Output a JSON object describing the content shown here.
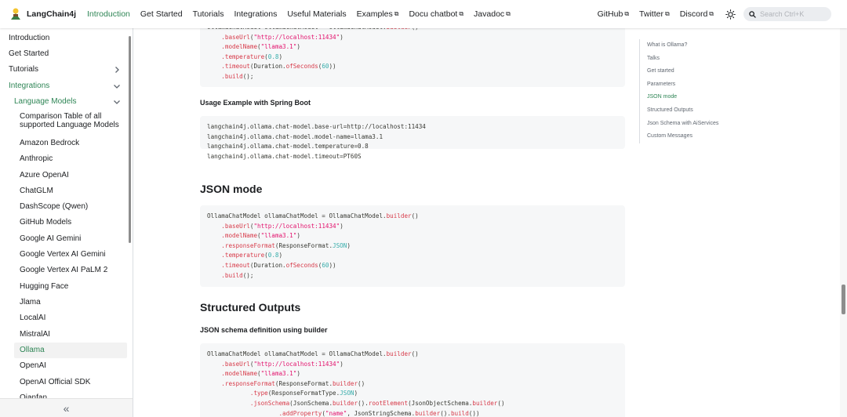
{
  "navbar": {
    "brand": "LangChain4j",
    "links": [
      {
        "label": "Introduction",
        "active": true,
        "external": false
      },
      {
        "label": "Get Started",
        "external": false
      },
      {
        "label": "Tutorials",
        "external": false
      },
      {
        "label": "Integrations",
        "external": false
      },
      {
        "label": "Useful Materials",
        "external": false
      },
      {
        "label": "Examples",
        "external": true
      },
      {
        "label": "Docu chatbot",
        "external": true
      },
      {
        "label": "Javadoc",
        "external": true
      }
    ],
    "right_links": [
      {
        "label": "GitHub",
        "external": true
      },
      {
        "label": "Twitter",
        "external": true
      },
      {
        "label": "Discord",
        "external": true
      }
    ],
    "search_placeholder": "Search Ctrl+K",
    "theme_icon": "sun-icon",
    "accent_color": "#2e8555"
  },
  "sidebar": {
    "items": [
      {
        "label": "Introduction"
      },
      {
        "label": "Get Started"
      },
      {
        "label": "Tutorials"
      },
      {
        "label": "Integrations"
      },
      {
        "label": "Language Models"
      },
      {
        "label": "Comparison Table of all supported Language Models"
      },
      {
        "label": "Amazon Bedrock"
      },
      {
        "label": "Anthropic"
      },
      {
        "label": "Azure OpenAI"
      },
      {
        "label": "ChatGLM"
      },
      {
        "label": "DashScope (Qwen)"
      },
      {
        "label": "GitHub Models"
      },
      {
        "label": "Google AI Gemini"
      },
      {
        "label": "Google Vertex AI Gemini"
      },
      {
        "label": "Google Vertex AI PaLM 2"
      },
      {
        "label": "Hugging Face"
      },
      {
        "label": "Jlama"
      },
      {
        "label": "LocalAI"
      },
      {
        "label": "MistralAI"
      },
      {
        "label": "Ollama"
      },
      {
        "label": "OpenAI"
      },
      {
        "label": "OpenAI Official SDK"
      },
      {
        "label": "Qianfan"
      }
    ],
    "collapse_label": "«"
  },
  "content": {
    "top_code": [
      "OllamaChatModel ollamaChatModel = OllamaChatModel.builder()",
      "    .baseUrl(\"http://localhost:11434\")",
      "    .modelName(\"llama3.1\")",
      "    .temperature(0.8)",
      "    .timeout(Duration.ofSeconds(60))",
      "    .build();"
    ],
    "spring_heading": "Usage Example with Spring Boot",
    "spring_code": [
      "langchain4j.ollama.chat-model.base-url=http://localhost:11434",
      "langchain4j.ollama.chat-model.model-name=llama3.1",
      "langchain4j.ollama.chat-model.temperature=0.8",
      "langchain4j.ollama.chat-model.timeout=PT60S"
    ],
    "json_mode_heading": "JSON mode",
    "json_code": [
      "OllamaChatModel ollamaChatModel = OllamaChatModel.builder()",
      "    .baseUrl(\"http://localhost:11434\")",
      "    .modelName(\"llama3.1\")",
      "    .responseFormat(ResponseFormat.JSON)",
      "    .temperature(0.8)",
      "    .timeout(Duration.ofSeconds(60))",
      "    .build();"
    ],
    "structured_heading": "Structured Outputs",
    "schema_heading": "JSON schema definition using builder",
    "schema_code": [
      "OllamaChatModel ollamaChatModel = OllamaChatModel.builder()",
      "    .baseUrl(\"http://localhost:11434\")",
      "    .modelName(\"llama3.1\")",
      "    .responseFormat(ResponseFormat.builder()",
      "            .type(ResponseFormatType.JSON)",
      "            .jsonSchema(JsonSchema.builder().rootElement(JsonObjectSchema.builder()",
      "                    .addProperty(\"name\", JsonStringSchema.builder().build())"
    ]
  },
  "toc": {
    "items": [
      {
        "label": "What is Ollama?"
      },
      {
        "label": "Talks"
      },
      {
        "label": "Get started"
      },
      {
        "label": "Parameters"
      },
      {
        "label": "JSON mode",
        "active": true
      },
      {
        "label": "Structured Outputs"
      },
      {
        "label": "Json Schema with AiServices"
      },
      {
        "label": "Custom Messages"
      }
    ]
  }
}
